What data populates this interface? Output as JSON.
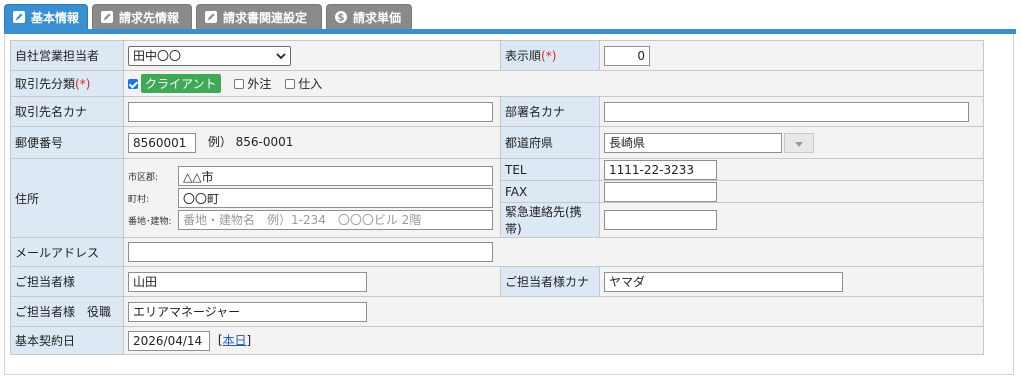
{
  "tabs": [
    {
      "label": "基本情報",
      "icon": "edit-icon",
      "active": true
    },
    {
      "label": "請求先情報",
      "icon": "edit-icon",
      "active": false
    },
    {
      "label": "請求書関連設定",
      "icon": "edit-icon",
      "active": false
    },
    {
      "label": "請求単価",
      "icon": "dollar-icon",
      "active": false
    }
  ],
  "colors": {
    "accent": "#3a8fd0",
    "label_bg": "#dce9f5",
    "required": "#e02020",
    "client_tag": "#3fa957"
  },
  "form": {
    "staff": {
      "label": "自社営業担当者",
      "value": "田中〇〇"
    },
    "display_order": {
      "label": "表示順",
      "required_mark": "(*)",
      "value": "0"
    },
    "partner_type": {
      "label": "取引先分類",
      "required_mark": "(*)",
      "options": [
        {
          "label": "クライアント",
          "checked": true
        },
        {
          "label": "外注",
          "checked": false
        },
        {
          "label": "仕入",
          "checked": false
        }
      ]
    },
    "partner_kana": {
      "label": "取引先名カナ",
      "value": ""
    },
    "dept_kana": {
      "label": "部署名カナ",
      "value": ""
    },
    "postal": {
      "label": "郵便番号",
      "value": "8560001",
      "example": "例） 856-0001"
    },
    "prefecture": {
      "label": "都道府県",
      "value": "長崎県"
    },
    "address": {
      "label": "住所",
      "city_label": "市区郡:",
      "city_value": "△△市",
      "town_label": "町村:",
      "town_value": "〇〇町",
      "street_label": "番地･建物:",
      "street_value": "",
      "street_placeholder": "番地・建物名　例）1-234　〇〇〇ビル 2階"
    },
    "tel": {
      "label": "TEL",
      "value": "1111-22-3233"
    },
    "fax": {
      "label": "FAX",
      "value": ""
    },
    "emergency": {
      "label": "緊急連絡先(携帯)",
      "value": ""
    },
    "email": {
      "label": "メールアドレス",
      "value": ""
    },
    "contact": {
      "label": "ご担当者様",
      "value": "山田"
    },
    "contact_kana": {
      "label": "ご担当者様カナ",
      "value": "ヤマダ"
    },
    "contact_title": {
      "label": "ご担当者様　役職",
      "value": "エリアマネージャー"
    },
    "contract_date": {
      "label": "基本契約日",
      "value": "2026/04/14",
      "bracket_open": "[",
      "today_link": "本日",
      "bracket_close": "]"
    }
  }
}
